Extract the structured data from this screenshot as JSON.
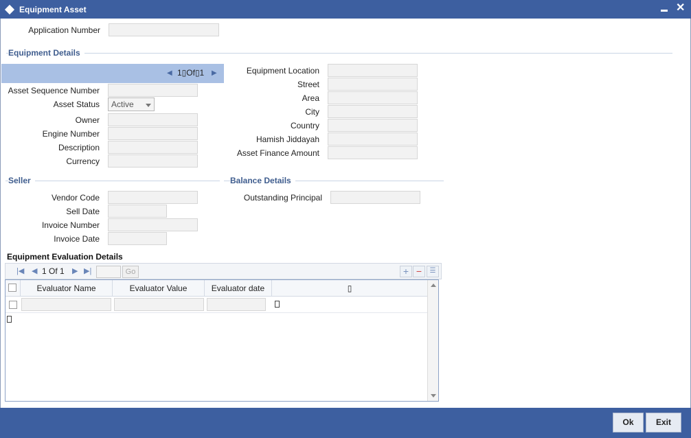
{
  "window": {
    "title": "Equipment Asset",
    "minimize": "▬",
    "close": "✕"
  },
  "application": {
    "label": "Application Number",
    "value": ""
  },
  "equipment_details": {
    "section_title": "Equipment Details",
    "pager": {
      "text": "1▯Of▯1"
    },
    "left_fields": [
      {
        "label": "Asset Sequence Number",
        "value": ""
      },
      {
        "label": "Asset Status",
        "value": "Active"
      },
      {
        "label": "Owner",
        "value": ""
      },
      {
        "label": "Engine Number",
        "value": ""
      },
      {
        "label": "Description",
        "value": ""
      },
      {
        "label": "Currency",
        "value": ""
      }
    ],
    "right_fields": [
      {
        "label": "Equipment Location",
        "value": ""
      },
      {
        "label": "Street",
        "value": ""
      },
      {
        "label": "Area",
        "value": ""
      },
      {
        "label": "City",
        "value": ""
      },
      {
        "label": "Country",
        "value": ""
      },
      {
        "label": "Hamish Jiddayah",
        "value": ""
      },
      {
        "label": "Asset Finance Amount",
        "value": ""
      }
    ]
  },
  "seller": {
    "section_title": "Seller",
    "fields": [
      {
        "label": "Vendor Code",
        "value": ""
      },
      {
        "label": "Sell Date",
        "value": ""
      },
      {
        "label": "Invoice Number",
        "value": ""
      },
      {
        "label": "Invoice Date",
        "value": ""
      }
    ]
  },
  "balance": {
    "section_title": "Balance Details",
    "fields": [
      {
        "label": "Outstanding Principal",
        "value": ""
      }
    ]
  },
  "evaluation": {
    "section_title": "Equipment Evaluation Details",
    "pager_text": "1 Of 1",
    "go_label": "Go",
    "columns": [
      "Evaluator Name",
      "Evaluator Value",
      "Evaluator date"
    ],
    "extra_col_glyph": "▯",
    "rows": [
      {
        "name": "",
        "value": "",
        "date": ""
      }
    ]
  },
  "footer": {
    "ok_label": "Ok",
    "exit_label": "Exit"
  },
  "colors": {
    "titlebar": "#3d5fa0",
    "section_title": "#3f5d8e",
    "pager_bar": "#a9c0e4"
  }
}
